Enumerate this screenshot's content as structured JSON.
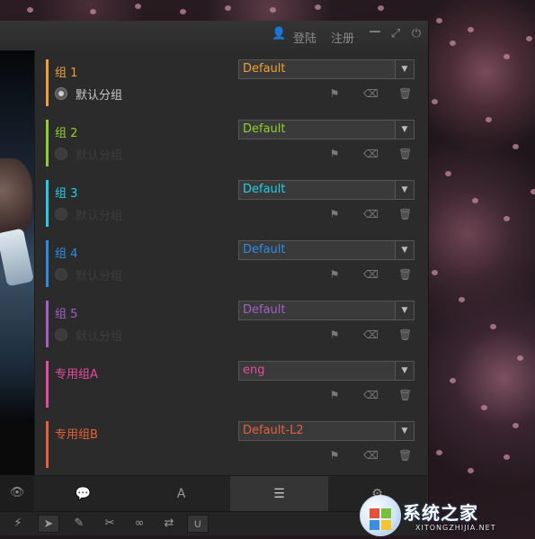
{
  "titlebar": {
    "user_icon": "user-icon",
    "login": "登陆",
    "register": "注册",
    "minimize_icon": "minimize-icon",
    "maximize_icon": "maximize-icon",
    "power_icon": "power-icon"
  },
  "groups": [
    {
      "name": "组 1",
      "color": "#f0a030",
      "select": "Default",
      "radio_label": "默认分组",
      "radio_on": true
    },
    {
      "name": "组 2",
      "color": "#8fd12a",
      "select": "Default",
      "radio_label": "默认分组",
      "radio_on": false
    },
    {
      "name": "组 3",
      "color": "#20d0e8",
      "select": "Default",
      "radio_label": "默认分组",
      "radio_on": false
    },
    {
      "name": "组 4",
      "color": "#2a8ee8",
      "select": "Default",
      "radio_label": "默认分组",
      "radio_on": false
    },
    {
      "name": "组 5",
      "color": "#a060c8",
      "select": "Default",
      "radio_label": "默认分组",
      "radio_on": false
    },
    {
      "name": "专用组A",
      "color": "#e84aa0",
      "select": "eng",
      "radio_label": "",
      "radio_on": false
    },
    {
      "name": "专用组B",
      "color": "#e8603a",
      "select": "Default-L2",
      "radio_label": "",
      "radio_on": false
    }
  ],
  "group_actions": [
    "flag-icon",
    "eraser-icon",
    "trash-icon"
  ],
  "tabs": [
    {
      "icon": "comment-icon",
      "glyph": "💬",
      "active": false
    },
    {
      "icon": "font-icon",
      "glyph": "A",
      "active": false
    },
    {
      "icon": "list-icon",
      "glyph": "☰",
      "active": true
    },
    {
      "icon": "settings-icon",
      "glyph": "⚙",
      "active": false
    }
  ],
  "eye_icon": "eye-icon",
  "tools": [
    "magic-wand-icon",
    "pointer-icon",
    "edit-icon",
    "scissors-icon",
    "link-icon",
    "swap-icon",
    "magnet-icon"
  ],
  "watermark": {
    "title": "系统之家",
    "subtitle": "XITONGZHIJIA.NET"
  }
}
